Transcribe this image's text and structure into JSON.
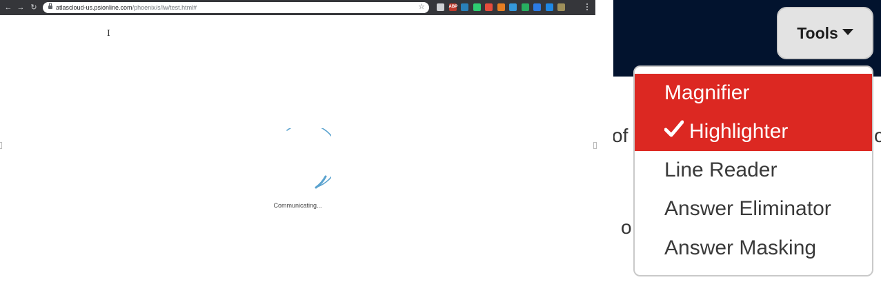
{
  "browser": {
    "url_host": "atlascloud-us.psionline.com",
    "url_path": "/phoenix/s/lw/test.html#",
    "extensions": [
      {
        "name": "cast-icon",
        "color": "#cfd1d4",
        "label": ""
      },
      {
        "name": "adblock-icon",
        "color": "#c0392b",
        "label": "ABP"
      },
      {
        "name": "extension-globe-icon",
        "color": "#2980b9",
        "label": ""
      },
      {
        "name": "extension-evernote-icon",
        "color": "#2ecc71",
        "label": ""
      },
      {
        "name": "extension-red-icon",
        "color": "#e74c3c",
        "label": ""
      },
      {
        "name": "extension-fire-icon",
        "color": "#e67e22",
        "label": ""
      },
      {
        "name": "extension-save-icon",
        "color": "#3498db",
        "label": ""
      },
      {
        "name": "extension-download-icon",
        "color": "#27ae60",
        "label": ""
      },
      {
        "name": "extension-blue-icon",
        "color": "#2c7be5",
        "label": ""
      },
      {
        "name": "extension-cloud-icon",
        "color": "#1e88e5",
        "label": ""
      },
      {
        "name": "extension-pause-icon",
        "color": "#9e8f5a",
        "label": ""
      }
    ],
    "status_text": "Communicating..."
  },
  "toolbar": {
    "tools_label": "Tools",
    "menu_items": [
      {
        "label": "Magnifier",
        "active": true,
        "checked": false
      },
      {
        "label": "Highlighter",
        "active": true,
        "checked": true
      },
      {
        "label": "Line Reader",
        "active": false,
        "checked": false
      },
      {
        "label": "Answer Eliminator",
        "active": false,
        "checked": false
      },
      {
        "label": "Answer Masking",
        "active": false,
        "checked": false
      }
    ]
  },
  "background_text": {
    "fragment_left_1": "of",
    "fragment_right_1": "o",
    "fragment_left_2": "o"
  },
  "colors": {
    "accent_red": "#dc2822",
    "navbar": "#02132e",
    "spinner": "#5ba3cf"
  }
}
